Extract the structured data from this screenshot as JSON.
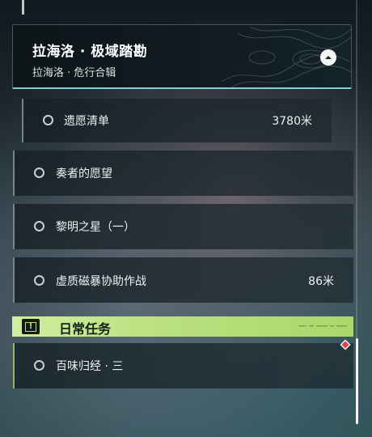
{
  "region": {
    "title": "拉海洛 · 极域踏勘",
    "subtitle": "拉海洛 · 危行合辑"
  },
  "quests": [
    {
      "name": "遗愿清单",
      "distance": "3780米"
    },
    {
      "name": "奏者的愿望",
      "distance": ""
    },
    {
      "name": "黎明之星（一）",
      "distance": ""
    },
    {
      "name": "虚质磁暴协助作战",
      "distance": "86米"
    }
  ],
  "daily": {
    "title": "日常任务",
    "quests": [
      {
        "name": "百味归经 · 三"
      }
    ]
  },
  "colors": {
    "accent_cyan": "#7fd2d2",
    "daily_green": "#b9e07e",
    "marker_red": "#e0404a"
  },
  "icons": {
    "collapse": "chevron-up-icon",
    "quest_status": "circle-outline-icon",
    "daily": "alert-square-icon",
    "tracking": "diamond-marker-icon"
  }
}
